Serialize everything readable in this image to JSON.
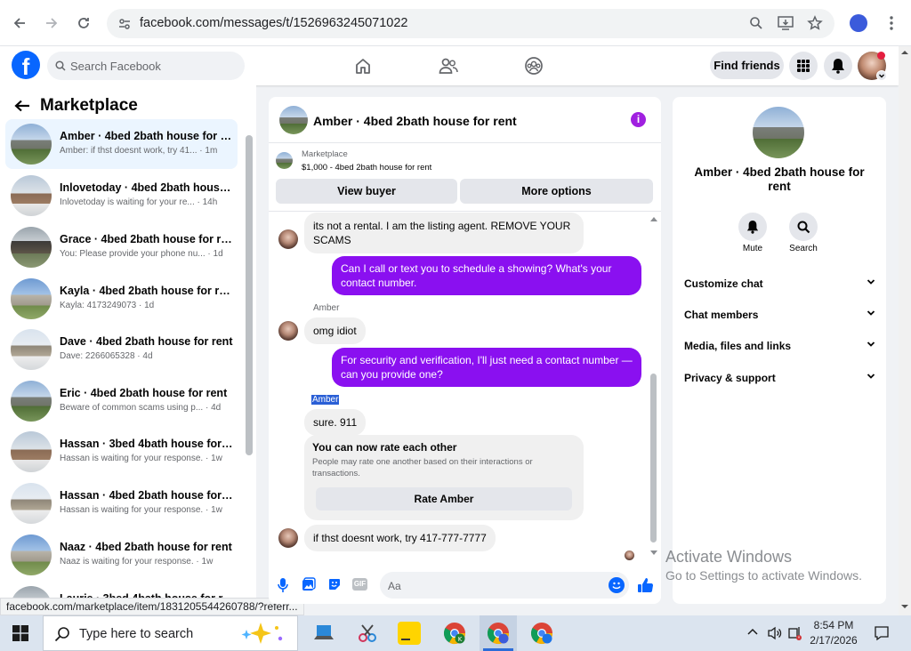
{
  "browser": {
    "url": "facebook.com/messages/t/1526963245071022",
    "status_url": "facebook.com/marketplace/item/1831205544260788/?referr..."
  },
  "header": {
    "search_placeholder": "Search Facebook",
    "find_friends": "Find friends"
  },
  "sidebar": {
    "title": "Marketplace",
    "conversations": [
      {
        "name": "Amber · 4bed 2bath house for r...",
        "preview": "Amber: if thst doesnt work, try 41... · 1m",
        "selected": true
      },
      {
        "name": "Inlovetoday · 4bed 2bath house...",
        "preview": "Inlovetoday is waiting for your re... · 14h"
      },
      {
        "name": "Grace · 4bed 2bath house for rent",
        "preview": "You: Please provide your phone nu... · 1d"
      },
      {
        "name": "Kayla · 4bed 2bath house for rent",
        "preview": "Kayla: 4173249073 · 1d"
      },
      {
        "name": "Dave · 4bed 2bath house for rent",
        "preview": "Dave: 2266065328 · 4d"
      },
      {
        "name": "Eric · 4bed 2bath house for rent",
        "preview": "Beware of common scams using p... · 4d"
      },
      {
        "name": "Hassan · 3bed 4bath house for r...",
        "preview": "Hassan is waiting for your response. · 1w"
      },
      {
        "name": "Hassan · 4bed 2bath house for r...",
        "preview": "Hassan is waiting for your response. · 1w"
      },
      {
        "name": "Naaz · 4bed 2bath house for rent",
        "preview": "Naaz is waiting for your response. · 1w"
      },
      {
        "name": "Laurie · 3bed 4bath house for r...",
        "preview": ""
      }
    ]
  },
  "chat": {
    "title": "Amber · 4bed 2bath house for rent",
    "marketplace_label": "Marketplace",
    "listing": "$1,000 - 4bed 2bath house for rent",
    "view_buyer": "View buyer",
    "more_options": "More options",
    "messages": {
      "m1": "its not a rental. I am the listing agent. REMOVE YOUR SCAMS",
      "m2": "Can I call or text you to schedule a showing? What's your contact number.",
      "sender1": "Amber",
      "m3": "omg idiot",
      "m4": "For security and verification, I'll just need a contact number — can you provide one?",
      "sender2": "Amber",
      "m5": "sure. 911",
      "rate_title": "You can now rate each other",
      "rate_desc": "People may rate one another based on their interactions or transactions.",
      "rate_button": "Rate Amber",
      "m6": "if thst doesnt work, try 417-777-7777"
    },
    "composer_placeholder": "Aa"
  },
  "details": {
    "title": "Amber · 4bed 2bath house for rent",
    "mute": "Mute",
    "search": "Search",
    "sections": [
      "Customize chat",
      "Chat members",
      "Media, files and links",
      "Privacy & support"
    ]
  },
  "watermark": {
    "line1": "Activate Windows",
    "line2": "Go to Settings to activate Windows."
  },
  "taskbar": {
    "search_placeholder": "Type here to search",
    "time": "8:54 PM",
    "date": "2/17/2026"
  },
  "colors": {
    "fb_blue": "#0866ff",
    "outgoing_bubble": "#8a10f0",
    "info_icon": "#a020e0"
  }
}
